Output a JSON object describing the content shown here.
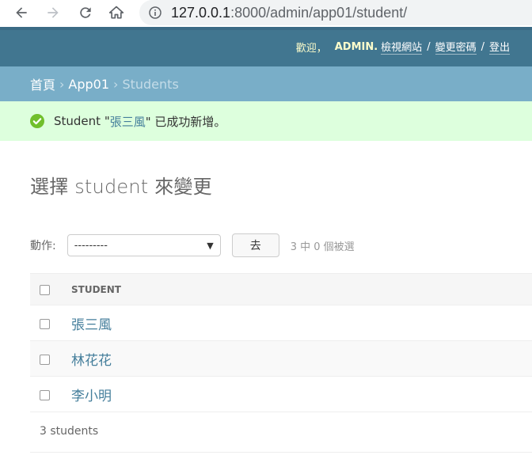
{
  "browser": {
    "url_host": "127.0.0.1",
    "url_path": ":8000/admin/app01/student/"
  },
  "header": {
    "welcome": "歡迎，",
    "username": "ADMIN.",
    "view_site": "檢視網站",
    "change_password": "變更密碼",
    "logout": "登出",
    "separator": "/"
  },
  "breadcrumbs": {
    "home": "首頁",
    "app": "App01",
    "current": "Students",
    "separator": "›"
  },
  "message": {
    "prefix": "Student \"",
    "link": "張三風",
    "suffix": "\" 已成功新增。"
  },
  "page_title": "選擇 student 來變更",
  "actions": {
    "label": "動作:",
    "selected_option": "---------",
    "go_label": "去",
    "counter": "3 中 0 個被選"
  },
  "table": {
    "column_header": "STUDENT",
    "rows": [
      "張三風",
      "林花花",
      "李小明"
    ]
  },
  "paginator": "3 students",
  "colors": {
    "header_bg": "#417690",
    "breadcrumbs_bg": "#79aec8",
    "success_bg": "#ddffdd",
    "link": "#447e9b"
  }
}
